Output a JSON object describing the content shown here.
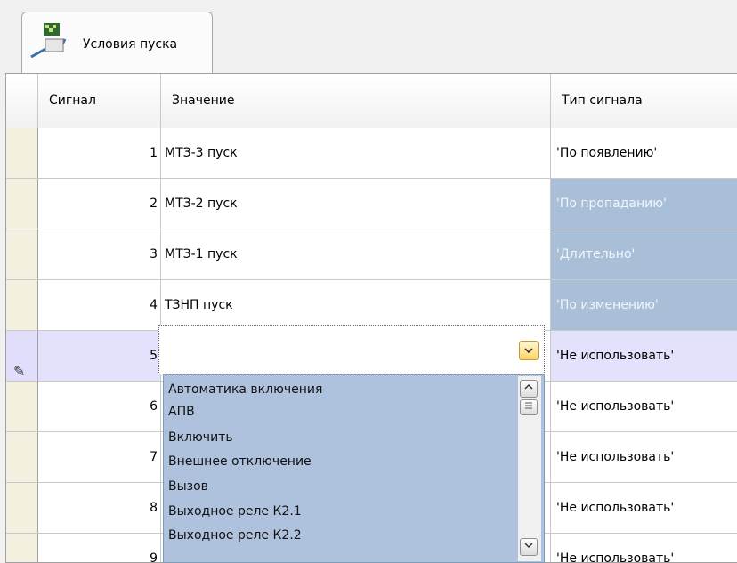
{
  "tab": {
    "label": "Условия пуска",
    "icon": "signal-start-icon"
  },
  "columns": {
    "signal": "Сигнал",
    "value": "Значение",
    "type": "Тип сигнала"
  },
  "rows": [
    {
      "signal": "1",
      "value": "МТЗ-3 пуск",
      "type": "'По появлению'",
      "selected": false
    },
    {
      "signal": "2",
      "value": "МТЗ-2 пуск",
      "type": "'По пропаданию'",
      "selected": true
    },
    {
      "signal": "3",
      "value": "МТЗ-1 пуск",
      "type": "'Длительно'",
      "selected": true
    },
    {
      "signal": "4",
      "value": "ТЗНП пуск",
      "type": "'По изменению'",
      "selected": true
    },
    {
      "signal": "5",
      "value": "",
      "type": "'Не использовать'",
      "selected": false
    },
    {
      "signal": "6",
      "value": "",
      "type": "'Не использовать'",
      "selected": false
    },
    {
      "signal": "7",
      "value": "",
      "type": "'Не использовать'",
      "selected": false
    },
    {
      "signal": "8",
      "value": "",
      "type": "'Не использовать'",
      "selected": false
    },
    {
      "signal": "9",
      "value": "",
      "type": "'Не использовать'",
      "selected": false
    }
  ],
  "dropdown": {
    "options": [
      "Автоматика включения",
      "АПВ",
      "Включить",
      "Внешнее отключение",
      "Вызов",
      "Выходное реле К2.1",
      "Выходное реле К2.2"
    ]
  },
  "colors": {
    "selected_type_bg": "#a9bfd8",
    "dropdown_bg": "#aec2dd",
    "active_row_bg": "#e2e2fc"
  }
}
